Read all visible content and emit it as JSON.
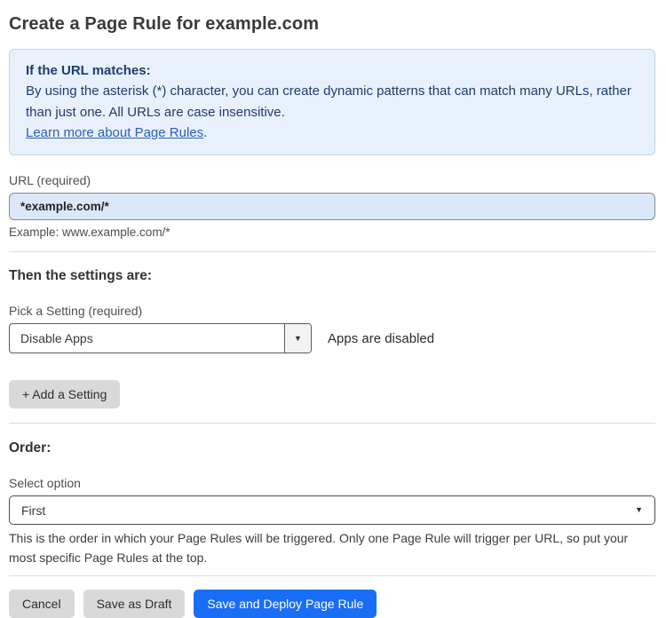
{
  "page": {
    "title": "Create a Page Rule for example.com"
  },
  "info_box": {
    "heading": "If the URL matches:",
    "body": "By using the asterisk (*) character, you can create dynamic patterns that can match many URLs, rather than just one. All URLs are case insensitive.",
    "link_label": "Learn more about Page Rules",
    "link_suffix": "."
  },
  "url_field": {
    "label": "URL (required)",
    "value": "*example.com/*",
    "helper": "Example: www.example.com/*"
  },
  "settings_section": {
    "heading": "Then the settings are:",
    "picker_label": "Pick a Setting (required)",
    "selected_setting": "Disable Apps",
    "setting_status": "Apps are disabled",
    "add_setting_label": "+ Add a Setting"
  },
  "order_section": {
    "heading": "Order:",
    "select_label": "Select option",
    "selected_option": "First",
    "helper": "This is the order in which your Page Rules will be triggered. Only one Page Rule will trigger per URL, so put your most specific Page Rules at the top."
  },
  "footer": {
    "cancel_label": "Cancel",
    "save_draft_label": "Save as Draft",
    "save_deploy_label": "Save and Deploy Page Rule"
  },
  "icons": {
    "caret_down": "▼"
  },
  "colors": {
    "accent_blue": "#1a6ef5",
    "info_background": "#e8f1fb",
    "info_border": "#bcd5ef",
    "info_text": "#1e3c6f",
    "link_blue": "#2c5db9",
    "input_background": "#dbe8f9",
    "gray_button": "#d9d9d9"
  }
}
